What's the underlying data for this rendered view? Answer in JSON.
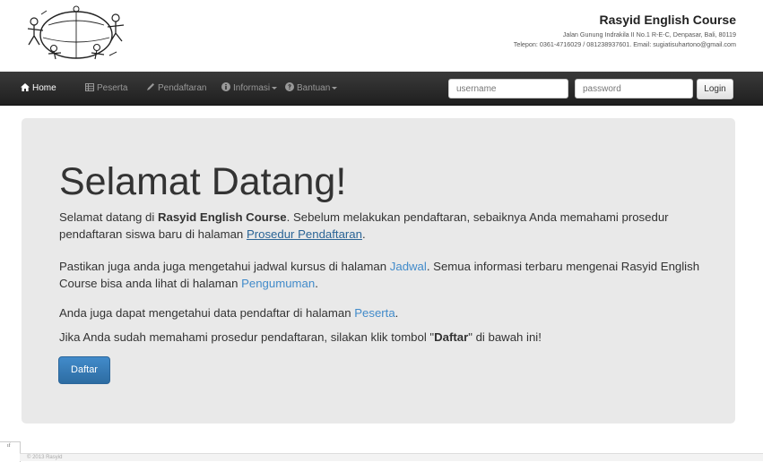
{
  "brand": {
    "name": "Rasyid English Course",
    "address": "Jalan Gunung Indrakila II No.1 R-E-C, Denpasar, Bali, 80119",
    "contact": "Telepon: 0361-4716029 / 081238937601. Email: sugiatisuhartono@gmail.com"
  },
  "nav": {
    "home": "Home",
    "peserta": "Peserta",
    "pendaftaran": "Pendaftaran",
    "informasi": "Informasi",
    "bantuan": "Bantuan",
    "username_placeholder": "username",
    "password_placeholder": "password",
    "login": "Login"
  },
  "jumbotron": {
    "title": "Selamat Datang!",
    "p1_pre": "Selamat datang di ",
    "p1_bold": "Rasyid English Course",
    "p1_mid": ". Sebelum melakukan pendaftaran, sebaiknya Anda memahami prosedur pendaftaran siswa baru di halaman ",
    "p1_link": "Prosedur Pendaftaran",
    "p1_end": ".",
    "p2_pre": "Pastikan juga anda juga mengetahui jadwal kursus di halaman ",
    "p2_link1": "Jadwal",
    "p2_mid": ". Semua informasi terbaru mengenai Rasyid English Course bisa anda lihat di halaman ",
    "p2_link2": "Pengumuman",
    "p2_end": ".",
    "p3_pre": "Anda juga dapat mengetahui data pendaftar di halaman ",
    "p3_link": "Peserta",
    "p3_end": ".",
    "p4_pre": "Jika Anda sudah memahami prosedur pendaftaran, silakan klik tombol \"",
    "p4_bold": "Daftar",
    "p4_end": "\" di bawah ini!",
    "button": "Daftar"
  },
  "footer": {
    "corner_glyph": "ıf",
    "text": "© 2013 Rasyid"
  },
  "icons": {
    "home": "home-icon",
    "peserta": "table-icon",
    "pendaftaran": "pencil-icon",
    "informasi": "info-icon",
    "bantuan": "question-icon"
  },
  "colors": {
    "navbar": "#222222",
    "jumbotron": "#e9e9e9",
    "primary": "#428bca",
    "link": "#428bca"
  }
}
